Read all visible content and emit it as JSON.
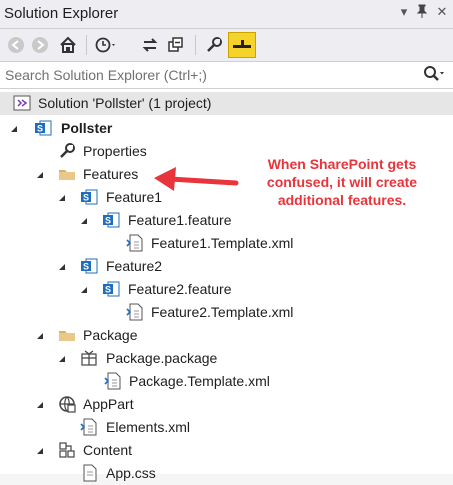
{
  "window": {
    "title": "Solution Explorer"
  },
  "toolbar": {
    "buttons": [
      "back-icon",
      "forward-icon",
      "home-icon",
      "history-icon",
      "sync-icon",
      "collapse-all-icon",
      "properties-icon",
      "preview-icon"
    ]
  },
  "search": {
    "placeholder": "Search Solution Explorer (Ctrl+;)"
  },
  "tree": {
    "solution": "Solution 'Pollster' (1 project)",
    "project": "Pollster",
    "properties": "Properties",
    "features": "Features",
    "feature1": "Feature1",
    "feature1_file": "Feature1.feature",
    "feature1_template": "Feature1.Template.xml",
    "feature2": "Feature2",
    "feature2_file": "Feature2.feature",
    "feature2_template": "Feature2.Template.xml",
    "package": "Package",
    "package_file": "Package.package",
    "package_template": "Package.Template.xml",
    "apppart": "AppPart",
    "elements": "Elements.xml",
    "content": "Content",
    "appcss": "App.css"
  },
  "annotation": {
    "text": "When SharePoint gets confused, it will create additional features.",
    "color": "#e8343a"
  },
  "colors": {
    "accent_yellow": "#f5d32a",
    "sp_blue": "#1f6dbf",
    "folder": "#d8b26b"
  }
}
